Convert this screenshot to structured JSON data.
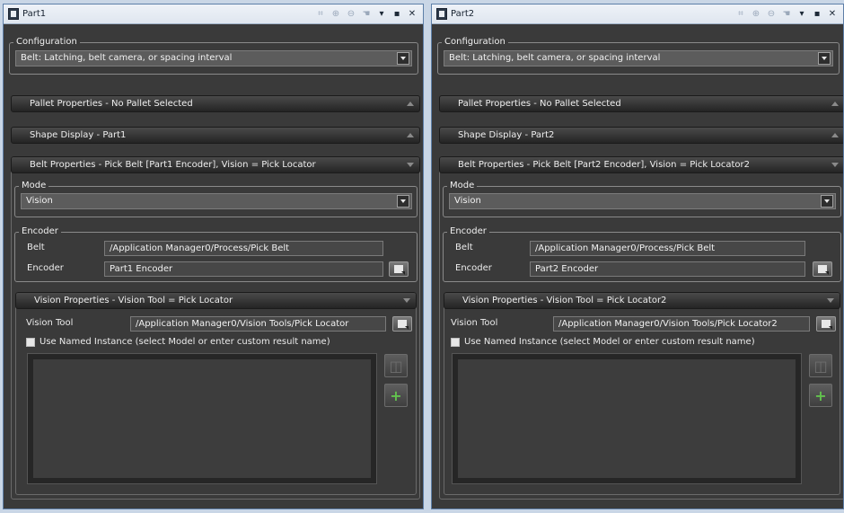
{
  "panels": [
    {
      "title": "Part1",
      "configuration_label": "Configuration",
      "configuration_value": "Belt: Latching, belt camera, or spacing interval",
      "pallet_header": "Pallet Properties - No Pallet Selected",
      "shape_header": "Shape Display - Part1",
      "belt_header": "Belt Properties -  Pick Belt [Part1 Encoder], Vision = Pick Locator",
      "mode_label": "Mode",
      "mode_value": "Vision",
      "encoder_group_label": "Encoder",
      "belt_label": "Belt",
      "belt_value": "/Application Manager0/Process/Pick Belt",
      "encoder_label": "Encoder",
      "encoder_value": "Part1 Encoder",
      "vision_header": "Vision Properties - Vision Tool = Pick Locator",
      "vision_tool_label": "Vision Tool",
      "vision_tool_value": "/Application Manager0/Vision Tools/Pick Locator",
      "named_instance_label": "Use Named Instance (select Model or enter custom result name)"
    },
    {
      "title": "Part2",
      "configuration_label": "Configuration",
      "configuration_value": "Belt: Latching, belt camera, or spacing interval",
      "pallet_header": "Pallet Properties - No Pallet Selected",
      "shape_header": "Shape Display - Part2",
      "belt_header": "Belt Properties -  Pick Belt [Part2 Encoder], Vision = Pick Locator2",
      "mode_label": "Mode",
      "mode_value": "Vision",
      "encoder_group_label": "Encoder",
      "belt_label": "Belt",
      "belt_value": "/Application Manager0/Process/Pick Belt",
      "encoder_label": "Encoder",
      "encoder_value": "Part2 Encoder",
      "vision_header": "Vision Properties - Vision Tool = Pick Locator2",
      "vision_tool_label": "Vision Tool",
      "vision_tool_value": "/Application Manager0/Vision Tools/Pick Locator2",
      "named_instance_label": "Use Named Instance (select Model or enter custom result name)"
    }
  ],
  "icons": {
    "titlebar_tools": [
      "fit-icon",
      "zoom-in-icon",
      "zoom-out-icon",
      "pan-icon",
      "menu-dropdown-icon",
      "restore-icon",
      "close-icon"
    ]
  },
  "colors": {
    "panel_bg": "#3a3a3a",
    "header_bar": "#242424",
    "add_green": "#62c24e",
    "window_border": "#5e7fa8"
  }
}
